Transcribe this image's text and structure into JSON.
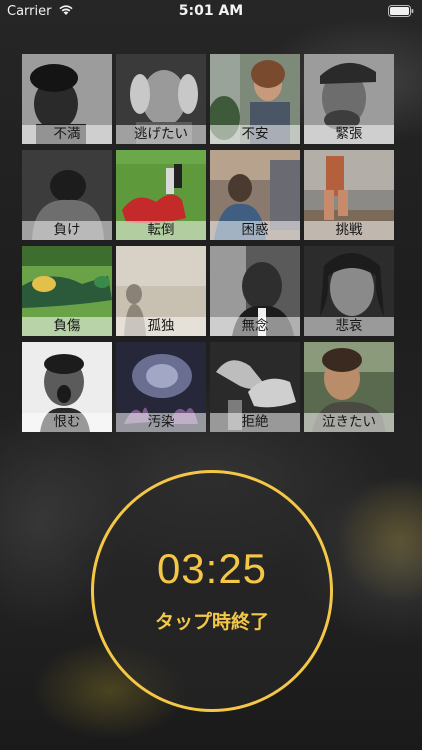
{
  "status_bar": {
    "carrier": "Carrier",
    "time": "5:01 AM"
  },
  "tiles": [
    {
      "label": "不満"
    },
    {
      "label": "逃げたい"
    },
    {
      "label": "不安"
    },
    {
      "label": "緊張"
    },
    {
      "label": "負け"
    },
    {
      "label": "転倒"
    },
    {
      "label": "困惑"
    },
    {
      "label": "挑戦"
    },
    {
      "label": "負傷"
    },
    {
      "label": "孤独"
    },
    {
      "label": "無念"
    },
    {
      "label": "悲哀"
    },
    {
      "label": "恨む"
    },
    {
      "label": "汚染"
    },
    {
      "label": "拒絶"
    },
    {
      "label": "泣きたい"
    }
  ],
  "timer": {
    "time": "03:25",
    "caption": "タップ時終了"
  },
  "colors": {
    "accent": "#f4c747"
  }
}
